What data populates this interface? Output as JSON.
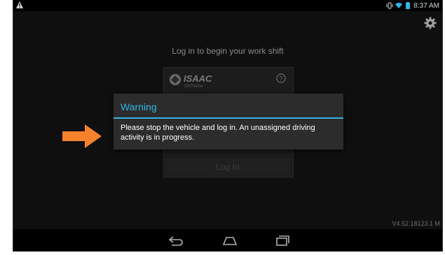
{
  "status_bar": {
    "time": "8:37 AM",
    "icons": [
      "alert-icon",
      "vibrate-icon",
      "wifi-icon",
      "battery-icon"
    ]
  },
  "login": {
    "title": "Log in to begin your work shift",
    "logo_text": "ISAAC",
    "logo_subtext": "OnTheGo",
    "login_button": "Log In"
  },
  "dialog": {
    "title": "Warning",
    "message": "Please stop the vehicle and log in. An unassigned driving activity is in progress."
  },
  "version": "V4.52.18123.1 M",
  "colors": {
    "accent": "#33b5e5",
    "arrow": "#f5822a",
    "background": "#0f0f0f"
  }
}
